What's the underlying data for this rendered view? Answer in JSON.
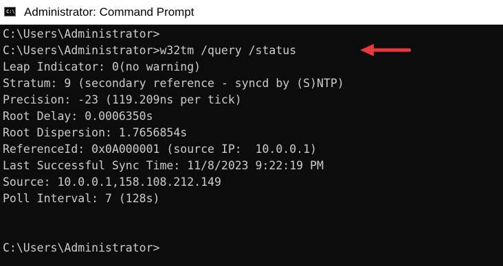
{
  "window": {
    "title": "Administrator: Command Prompt",
    "icon": "cmd-icon",
    "icon_glyph": "C:\\"
  },
  "console": {
    "lines": [
      "C:\\Users\\Administrator>",
      "C:\\Users\\Administrator>w32tm /query /status",
      "Leap Indicator: 0(no warning)",
      "Stratum: 9 (secondary reference - syncd by (S)NTP)",
      "Precision: -23 (119.209ns per tick)",
      "Root Delay: 0.0006350s",
      "Root Dispersion: 1.7656854s",
      "ReferenceId: 0x0A000001 (source IP:  10.0.0.1)",
      "Last Successful Sync Time: 11/8/2023 9:22:19 PM",
      "Source: 10.0.0.1,158.108.212.149",
      "Poll Interval: 7 (128s)",
      "",
      "",
      "C:\\Users\\Administrator>"
    ]
  },
  "annotation": {
    "icon": "arrow-left-icon",
    "color": "#e8393a"
  },
  "colors": {
    "console_background": "#0c0c0c",
    "console_text": "#cccccc",
    "titlebar_background": "#ffffff"
  }
}
